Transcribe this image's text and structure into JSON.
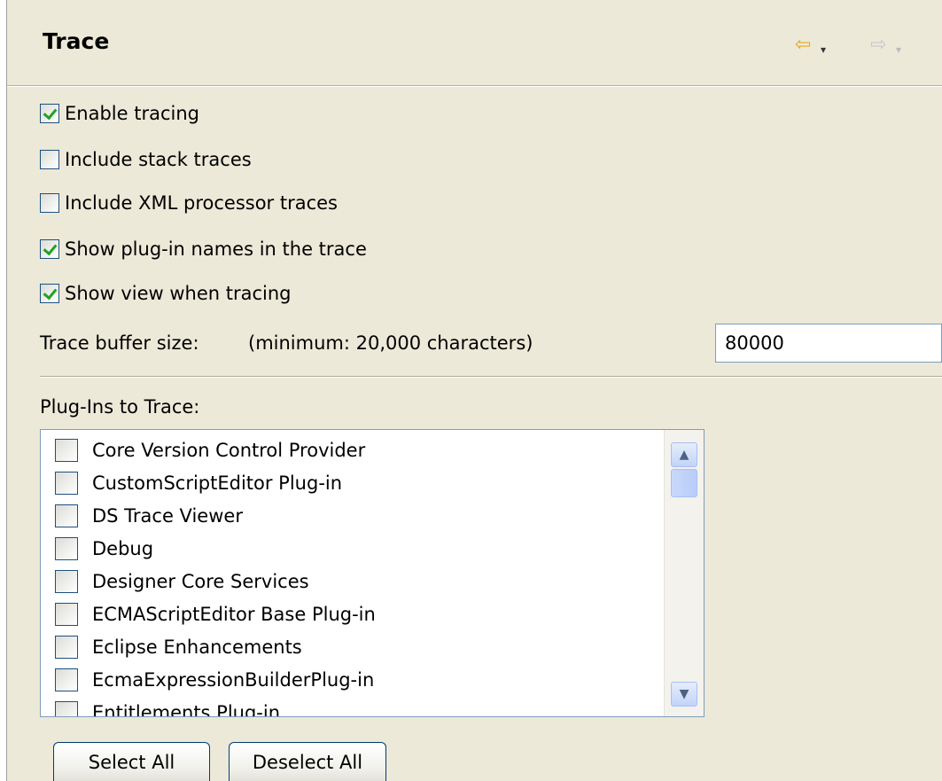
{
  "header": {
    "title": "Trace",
    "back_arrow": "⇦",
    "forward_arrow": "⇨",
    "dropdown_glyph": "▾"
  },
  "options": [
    {
      "label": "Enable tracing",
      "checked": true
    },
    {
      "label": "Include stack traces",
      "checked": false
    },
    {
      "label": "Include XML processor traces",
      "checked": false
    },
    {
      "label": "Show plug-in names in the trace",
      "checked": true
    },
    {
      "label": "Show view when tracing",
      "checked": true
    }
  ],
  "buffer": {
    "label": "Trace buffer size:",
    "hint": "(minimum: 20,000 characters)",
    "value": "80000"
  },
  "plugins": {
    "label": "Plug-Ins to Trace:",
    "items": [
      {
        "label": "Core Version Control Provider",
        "checked": false
      },
      {
        "label": "CustomScriptEditor Plug-in",
        "checked": false
      },
      {
        "label": "DS Trace Viewer",
        "checked": false
      },
      {
        "label": "Debug",
        "checked": false
      },
      {
        "label": "Designer Core Services",
        "checked": false
      },
      {
        "label": "ECMAScriptEditor Base Plug-in",
        "checked": false
      },
      {
        "label": "Eclipse Enhancements",
        "checked": false
      },
      {
        "label": "EcmaExpressionBuilderPlug-in",
        "checked": false
      },
      {
        "label": "Entitlements Plug-in",
        "checked": false
      }
    ]
  },
  "scrollbar": {
    "up_glyph": "▲",
    "down_glyph": "▼"
  },
  "buttons": {
    "select_all": "Select All",
    "deselect_all": "Deselect All"
  },
  "colors": {
    "background": "#ece9d8",
    "check_green": "#21a121",
    "checkbox_border": "#1c5180",
    "back_arrow": "#e8a820"
  }
}
